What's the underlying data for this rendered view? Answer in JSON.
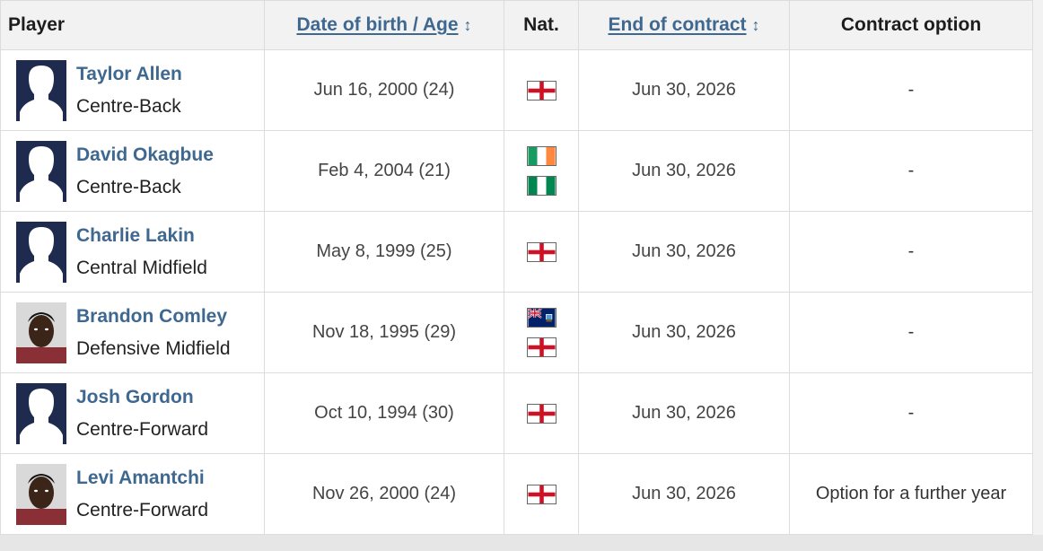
{
  "headers": {
    "player": "Player",
    "dob_age": "Date of birth / Age",
    "nat": "Nat.",
    "end_contract": "End of contract",
    "contract_option": "Contract option"
  },
  "sort_icon": "sort-arrows-icon",
  "colors": {
    "link": "#3f6890",
    "header_bg": "#f2f2f2",
    "border": "#dcdcdc"
  },
  "rows": [
    {
      "name": "Taylor Allen",
      "position": "Centre-Back",
      "dob": "Jun 16, 2000 (24)",
      "nat": [
        "England"
      ],
      "end": "Jun 30, 2026",
      "option": "-",
      "avatar": "silhouette"
    },
    {
      "name": "David Okagbue",
      "position": "Centre-Back",
      "dob": "Feb 4, 2004 (21)",
      "nat": [
        "Ireland",
        "Nigeria"
      ],
      "end": "Jun 30, 2026",
      "option": "-",
      "avatar": "silhouette"
    },
    {
      "name": "Charlie Lakin",
      "position": "Central Midfield",
      "dob": "May 8, 1999 (25)",
      "nat": [
        "England"
      ],
      "end": "Jun 30, 2026",
      "option": "-",
      "avatar": "silhouette"
    },
    {
      "name": "Brandon Comley",
      "position": "Defensive Midfield",
      "dob": "Nov 18, 1995 (29)",
      "nat": [
        "Montserrat",
        "England"
      ],
      "end": "Jun 30, 2026",
      "option": "-",
      "avatar": "photo"
    },
    {
      "name": "Josh Gordon",
      "position": "Centre-Forward",
      "dob": "Oct 10, 1994 (30)",
      "nat": [
        "England"
      ],
      "end": "Jun 30, 2026",
      "option": "-",
      "avatar": "silhouette"
    },
    {
      "name": "Levi Amantchi",
      "position": "Centre-Forward",
      "dob": "Nov 26, 2000 (24)",
      "nat": [
        "England"
      ],
      "end": "Jun 30, 2026",
      "option": "Option for a further year",
      "avatar": "photo"
    }
  ]
}
